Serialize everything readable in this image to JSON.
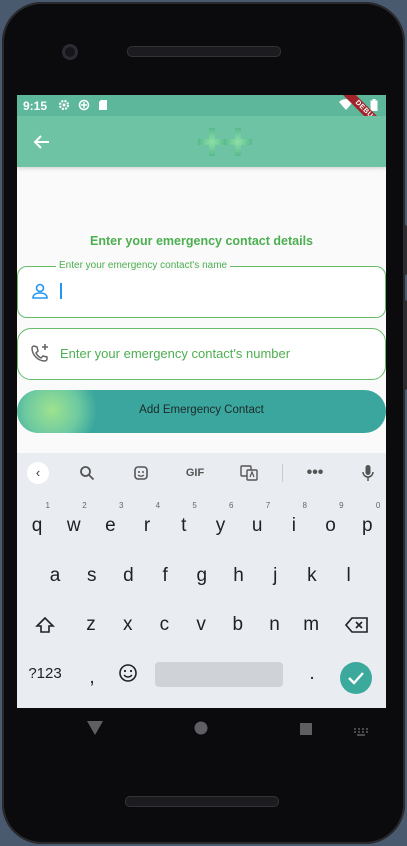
{
  "status_bar": {
    "time": "9:15",
    "debug_banner": "DEBUG"
  },
  "app_bar": {
    "back_icon": "arrow-left-icon",
    "logo": "green-cross-logo"
  },
  "form": {
    "heading": "Enter your emergency contact details",
    "name_field": {
      "label": "Enter your emergency contact's name",
      "value": "",
      "icon": "person-icon"
    },
    "number_field": {
      "placeholder": "Enter your emergency contact's number",
      "icon": "add-call-icon"
    }
  },
  "add_button": {
    "label": "Add Emergency Contact"
  },
  "keyboard": {
    "toolbar": [
      "back",
      "search",
      "sticker",
      "GIF",
      "translate",
      "more",
      "mic"
    ],
    "gif_label": "GIF",
    "row1": [
      {
        "k": "q",
        "n": "1"
      },
      {
        "k": "w",
        "n": "2"
      },
      {
        "k": "e",
        "n": "3"
      },
      {
        "k": "r",
        "n": "4"
      },
      {
        "k": "t",
        "n": "5"
      },
      {
        "k": "y",
        "n": "6"
      },
      {
        "k": "u",
        "n": "7"
      },
      {
        "k": "i",
        "n": "8"
      },
      {
        "k": "o",
        "n": "9"
      },
      {
        "k": "p",
        "n": "0"
      }
    ],
    "row2": [
      "a",
      "s",
      "d",
      "f",
      "g",
      "h",
      "j",
      "k",
      "l"
    ],
    "row3": [
      "z",
      "x",
      "c",
      "v",
      "b",
      "n",
      "m"
    ],
    "symbols_key": "?123",
    "comma_key": ",",
    "period_key": "."
  },
  "colors": {
    "primary": "#6ec3a5",
    "accent_green": "#4caf50",
    "button": "#3aa69e",
    "debug": "#a0252a"
  }
}
